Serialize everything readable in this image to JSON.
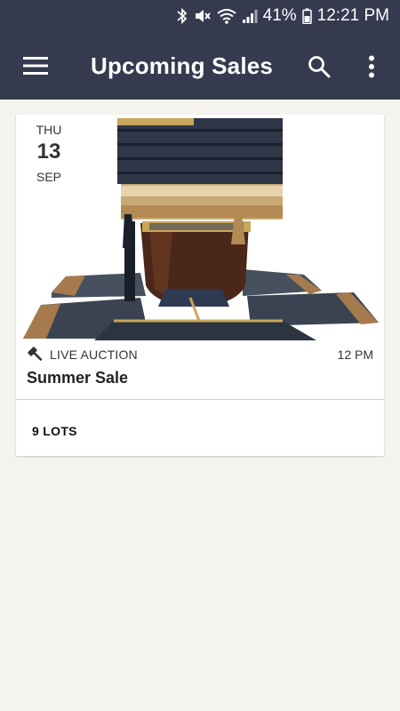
{
  "status_bar": {
    "battery": "41%",
    "time": "12:21 PM",
    "icons": [
      "bluetooth-icon",
      "mute-icon",
      "wifi-icon",
      "signal-icon",
      "battery-icon"
    ]
  },
  "app_bar": {
    "title": "Upcoming Sales",
    "background": "#353a4f",
    "icons": [
      "menu-icon",
      "search-icon",
      "more-vertical-icon"
    ]
  },
  "sales": [
    {
      "date": {
        "day_of_week": "THU",
        "day": "13",
        "month": "SEP"
      },
      "image": "samurai-armor",
      "type_icon": "gavel-icon",
      "type": "LIVE AUCTION",
      "time": "12 PM",
      "name": "Summer Sale",
      "lots": "9 LOTS"
    }
  ]
}
